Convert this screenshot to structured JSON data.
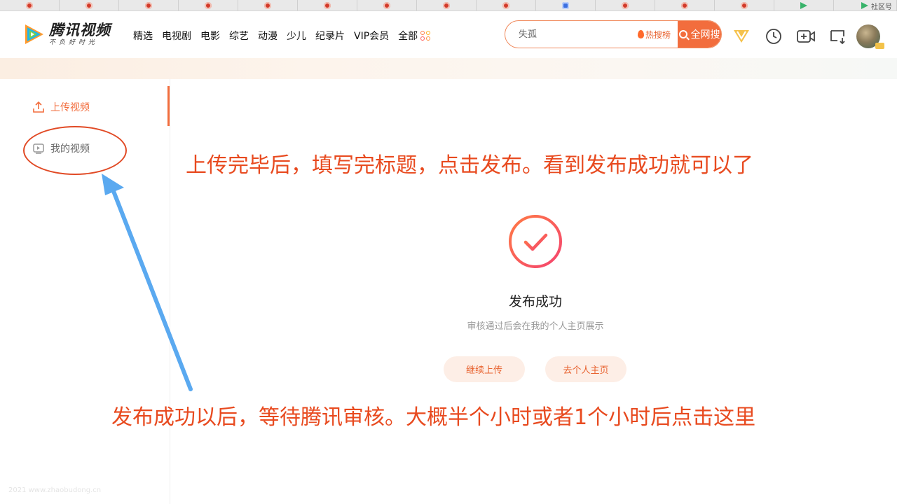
{
  "browser": {
    "last_tab_label": "社区号"
  },
  "header": {
    "logo": {
      "name": "腾讯视频",
      "slogan": "不负好时光"
    },
    "nav": [
      "精选",
      "电视剧",
      "电影",
      "综艺",
      "动漫",
      "少儿",
      "纪录片",
      "VIP会员",
      "全部"
    ],
    "search": {
      "placeholder": "失孤",
      "hot_label": "热搜榜",
      "button_label": "全网搜"
    },
    "tools": [
      "vip-icon",
      "history-icon",
      "upload-video-icon",
      "download-icon",
      "avatar"
    ]
  },
  "sidebar": {
    "items": [
      {
        "label": "上传视频",
        "icon": "upload-icon",
        "active": true
      },
      {
        "label": "我的视频",
        "icon": "video-icon",
        "active": false
      }
    ]
  },
  "main": {
    "status_title": "发布成功",
    "status_subtitle": "审核通过后会在我的个人主页展示",
    "buttons": {
      "continue_label": "继续上传",
      "profile_label": "去个人主页"
    }
  },
  "annotations": {
    "top_text": "上传完毕后，填写完标题，点击发布。看到发布成功就可以了",
    "bottom_text": "发布成功以后，等待腾讯审核。大概半个小时或者1个小时后点击这里"
  },
  "footer": {
    "watermark": "2021  www.zhaobudong.cn"
  },
  "colors": {
    "accent": "#f26d3d",
    "annotation": "#e84a1f",
    "arrow": "#5aa9f0"
  }
}
